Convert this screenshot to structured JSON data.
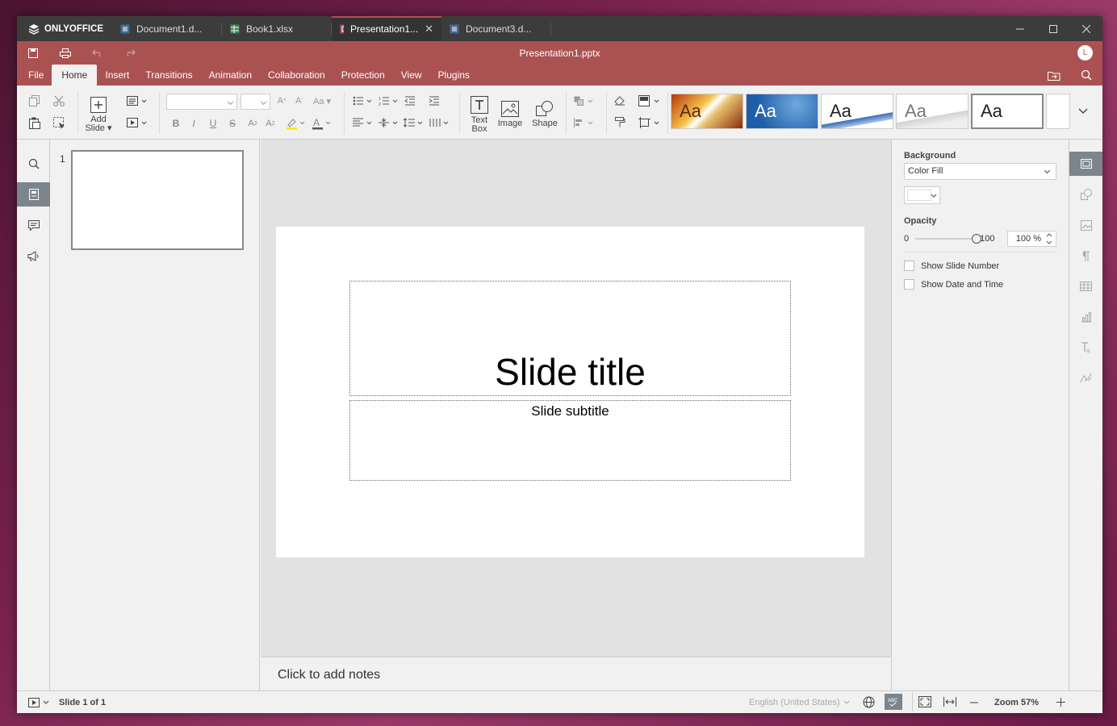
{
  "app": {
    "logo": "ONLYOFFICE"
  },
  "tabs": [
    {
      "label": "Document1.d...",
      "kind": "doc"
    },
    {
      "label": "Book1.xlsx",
      "kind": "sheet"
    },
    {
      "label": "Presentation1...",
      "kind": "slide"
    },
    {
      "label": "Document3.d...",
      "kind": "doc"
    }
  ],
  "title": {
    "doc_name": "Presentation1.pptx",
    "avatar_initial": "L"
  },
  "menu": {
    "tabs": [
      "File",
      "Home",
      "Insert",
      "Transitions",
      "Animation",
      "Collaboration",
      "Protection",
      "View",
      "Plugins"
    ],
    "active": "Home"
  },
  "toolbar": {
    "add_slide": "Add\nSlide",
    "text_box": "Text\nBox",
    "image": "Image",
    "shape": "Shape",
    "themes": [
      "Aa",
      "Aa",
      "Aa",
      "Aa",
      "Aa"
    ]
  },
  "thumbnails": {
    "number": "1"
  },
  "slide": {
    "title": "Slide title",
    "subtitle": "Slide subtitle"
  },
  "notes": {
    "placeholder": "Click to add notes"
  },
  "right_panel": {
    "background_label": "Background",
    "fill_type": "Color Fill",
    "opacity_label": "Opacity",
    "opacity_min": "0",
    "opacity_max": "100",
    "opacity_value": "100 %",
    "opacity_level": 1.0,
    "show_slide_number": "Show Slide Number",
    "show_date_time": "Show Date and Time"
  },
  "status": {
    "slide_info": "Slide 1 of 1",
    "language": "English (United States)",
    "zoom": "Zoom 57%"
  },
  "colors": {
    "accent": "#aa5252",
    "topbar": "#3c3c3c",
    "panel": "#f1f1f1"
  }
}
